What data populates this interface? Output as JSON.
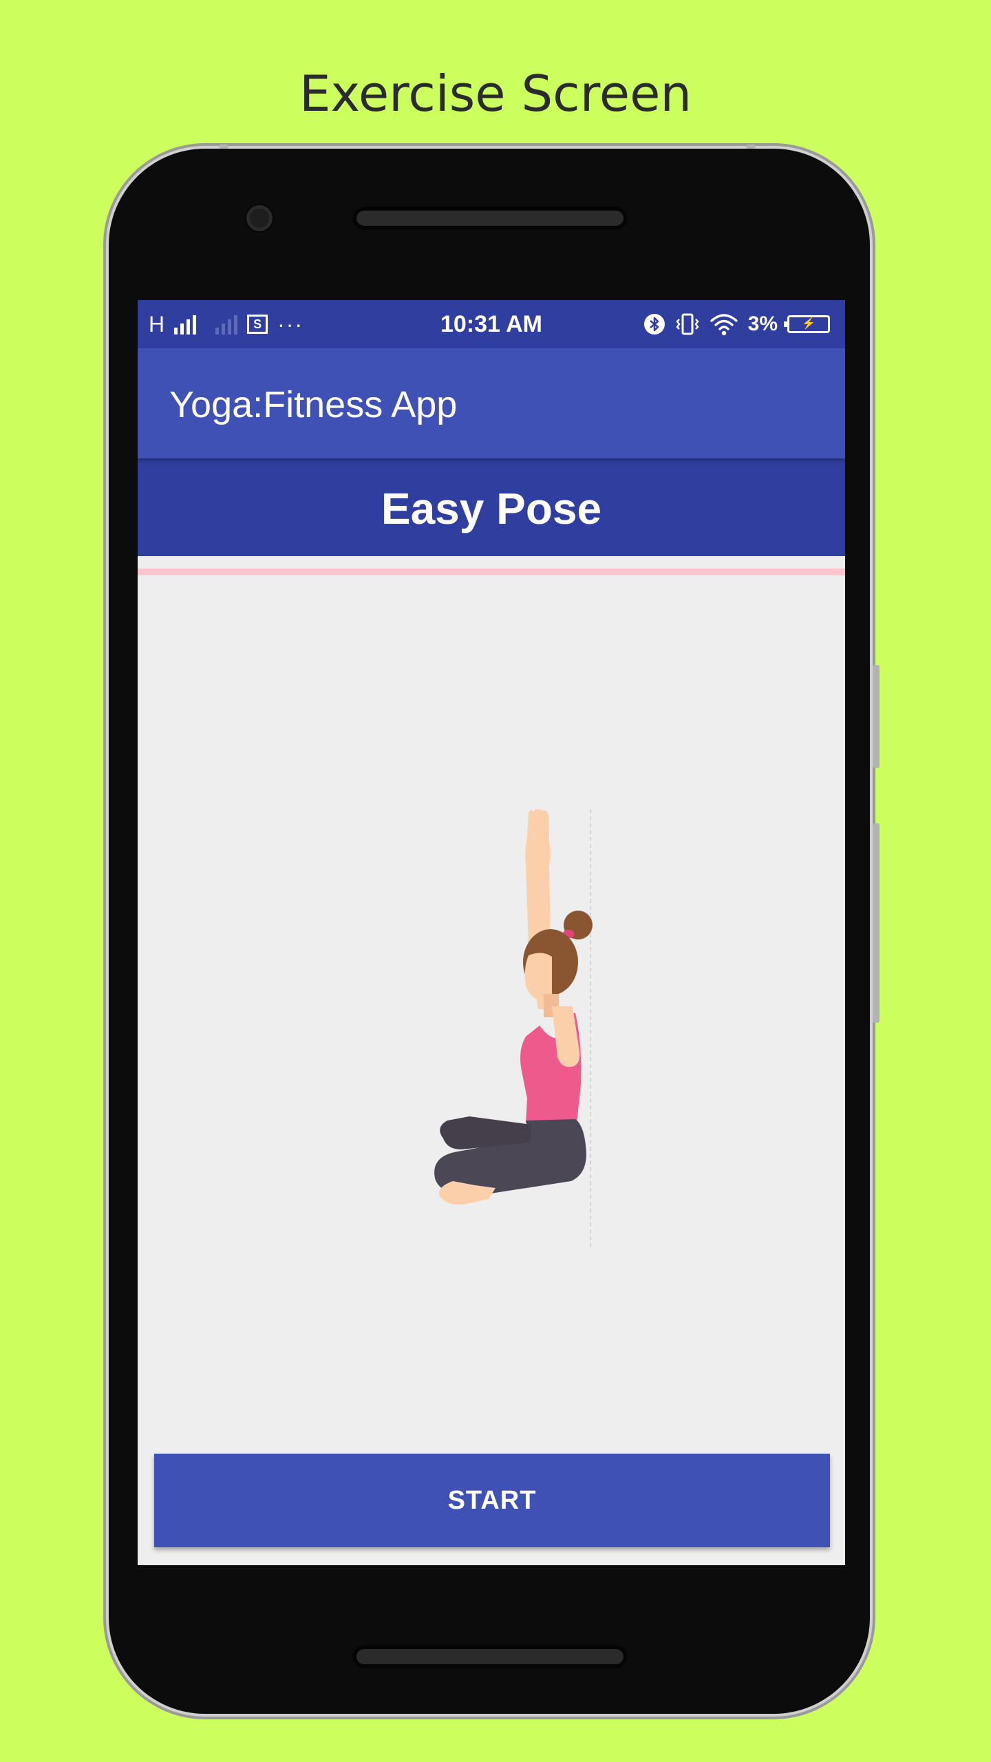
{
  "caption": "Exercise Screen",
  "status_bar": {
    "carrier": "H",
    "screenshot_icon_letter": "S",
    "more": "···",
    "time": "10:31 AM",
    "battery_percent": "3%",
    "icons": [
      "signal-icon",
      "signal-weak-icon",
      "screenshot-icon",
      "more-dots-icon",
      "bluetooth-icon",
      "vibrate-icon",
      "wifi-icon",
      "battery-charging-icon"
    ]
  },
  "app_bar": {
    "title": "Yoga:Fitness App"
  },
  "exercise": {
    "name": "Easy Pose",
    "progress": 0,
    "image": "easy-pose-illustration"
  },
  "actions": {
    "start_label": "START"
  },
  "colors": {
    "background": "#ccff5e",
    "primary": "#3f51b5",
    "primary_dark": "#303f9f",
    "progress_track": "#ffc4ce",
    "content_bg": "#eeeeee",
    "pose_top": "#ef5a8c",
    "pose_pants": "#4b4754",
    "skin": "#fbcfaa",
    "hair": "#8a5631"
  }
}
